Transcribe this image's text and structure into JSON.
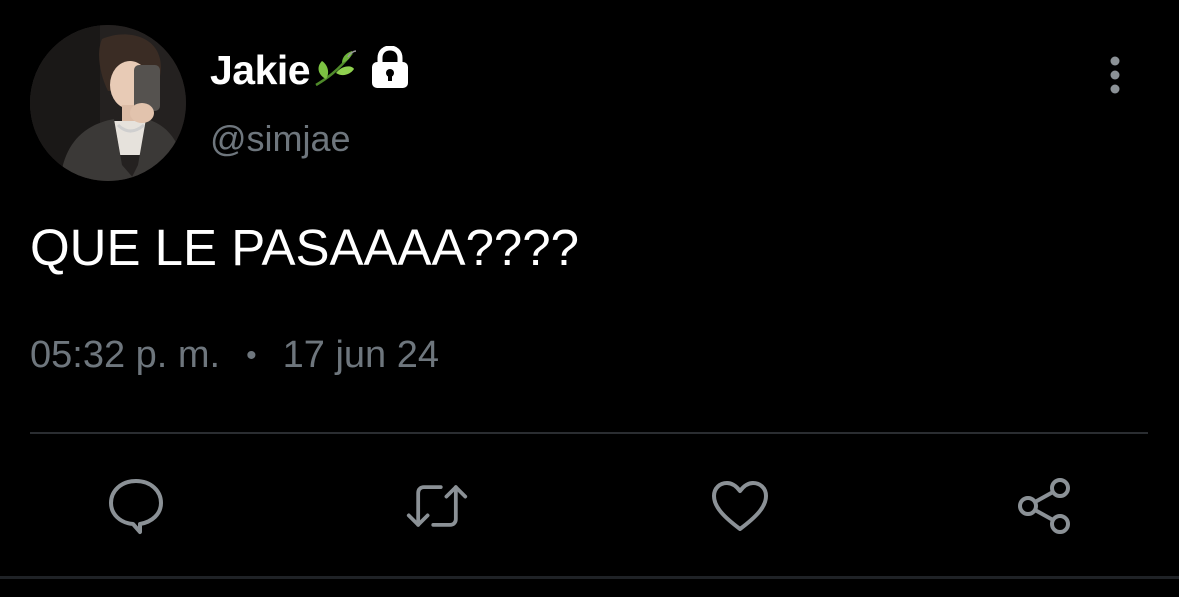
{
  "tweet": {
    "display_name": "Jakie",
    "handle": "@simjae",
    "text": "QUE LE PASAAAA????",
    "time": "05:32 p. m.",
    "separator": "•",
    "date": "17 jun 24"
  },
  "icons": {
    "name_emoji": "leaf-icon",
    "protected": "lock-icon",
    "more": "more-vertical-icon",
    "reply": "reply-icon",
    "retweet": "retweet-icon",
    "like": "heart-icon",
    "share": "share-icon"
  },
  "colors": {
    "background": "#000000",
    "primary_text": "#ffffff",
    "secondary_text": "#6e767d",
    "leaf_green": "#7cc242"
  }
}
